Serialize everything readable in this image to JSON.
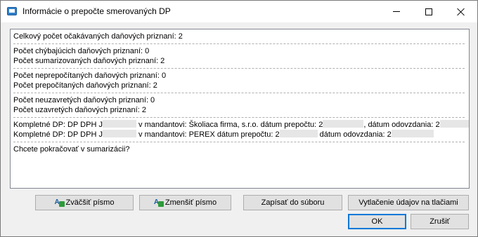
{
  "window": {
    "title": "Informácie o prepočte smerovaných DP",
    "minimize_glyph": "—",
    "close_glyph": "✕"
  },
  "message": {
    "total_line": "Celkový počet očakávaných daňových priznaní: 2",
    "missing_line": "Počet chýbajúcich daňových priznaní: 0",
    "summarized_line": "Počet sumarizovaných daňových priznaní: 2",
    "not_recalc_line": "Počet neprepočítaných daňových priznaní: 0",
    "recalc_line": "Počet prepočítaných daňových priznaní: 2",
    "not_closed_line": "Počet neuzavretých daňových priznaní: 0",
    "closed_line": "Počet uzavretých daňových priznaní: 2",
    "complete1_a": "Kompletné DP: DP DPH J",
    "complete1_b": " v mandantovi: Školiaca firma, s.r.o. dátum prepočtu: 2",
    "complete1_c": ", dátum odovzdania: 2",
    "complete2_a": "Kompletné DP: DP DPH J",
    "complete2_b": " v mandantovi: PEREX dátum prepočtu: 2",
    "complete2_c": " dátum odovzdania: 2",
    "question_line": "Chcete pokračovať v sumarizácii?"
  },
  "buttons": {
    "enlarge_font": "Zväčšiť písmo",
    "shrink_font": "Zmenšiť písmo",
    "save_to_file": "Zapísať do súboru",
    "print": "Vytlačenie údajov na tlačiami",
    "ok": "OK",
    "cancel": "Zrušiť",
    "font_icon_glyph": "A"
  }
}
